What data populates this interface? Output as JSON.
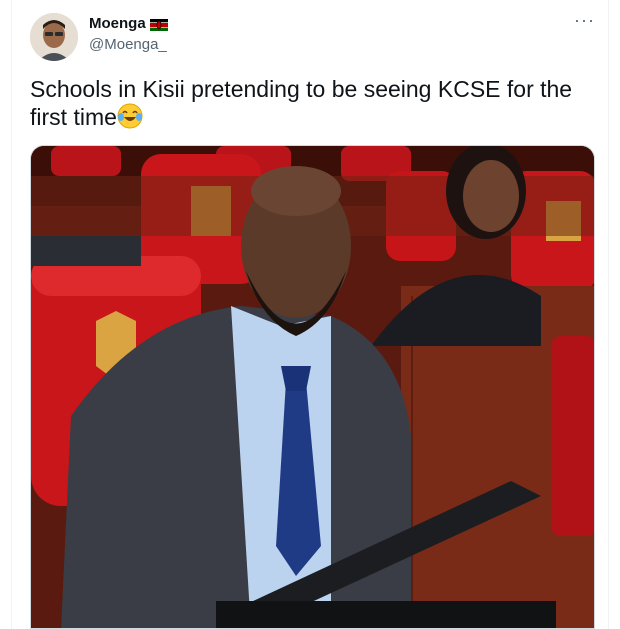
{
  "author": {
    "display_name": "Moenga",
    "handle": "@Moenga_",
    "flag_icon": "kenya-flag-icon"
  },
  "tweet": {
    "text": "Schools in Kisii pretending to be seeing KCSE for the first time",
    "emoji": "tears-of-joy-emoji"
  },
  "menu": {
    "more_icon": "more-options-icon"
  },
  "colors": {
    "text": "#0f1419",
    "secondary": "#536471",
    "chair_red": "#c9161b",
    "wood": "#7a2b18",
    "suit": "#3a3d45",
    "shirt": "#bcd3ef",
    "tie": "#1f3b86"
  }
}
